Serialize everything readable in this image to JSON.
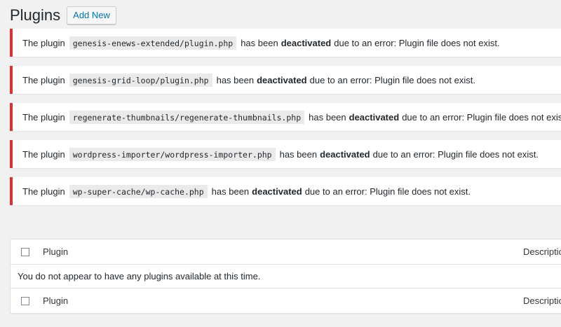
{
  "header": {
    "title": "Plugins",
    "add_new_label": "Add New"
  },
  "notices": [
    {
      "prefix": "The plugin",
      "file": "genesis-enews-extended/plugin.php",
      "middle": "has been",
      "status": "deactivated",
      "suffix": "due to an error: Plugin file does not exist."
    },
    {
      "prefix": "The plugin",
      "file": "genesis-grid-loop/plugin.php",
      "middle": "has been",
      "status": "deactivated",
      "suffix": "due to an error: Plugin file does not exist."
    },
    {
      "prefix": "The plugin",
      "file": "regenerate-thumbnails/regenerate-thumbnails.php",
      "middle": "has been",
      "status": "deactivated",
      "suffix": "due to an error: Plugin file does not exist."
    },
    {
      "prefix": "The plugin",
      "file": "wordpress-importer/wordpress-importer.php",
      "middle": "has been",
      "status": "deactivated",
      "suffix": "due to an error: Plugin file does not exist."
    },
    {
      "prefix": "The plugin",
      "file": "wp-super-cache/wp-cache.php",
      "middle": "has been",
      "status": "deactivated",
      "suffix": "due to an error: Plugin file does not exist."
    }
  ],
  "table": {
    "columns": [
      "Plugin",
      "Description"
    ],
    "empty_message": "You do not appear to have any plugins available at this time."
  },
  "colors": {
    "error_border": "#dc3232",
    "link": "#0073aa",
    "background": "#f1f1f1"
  }
}
